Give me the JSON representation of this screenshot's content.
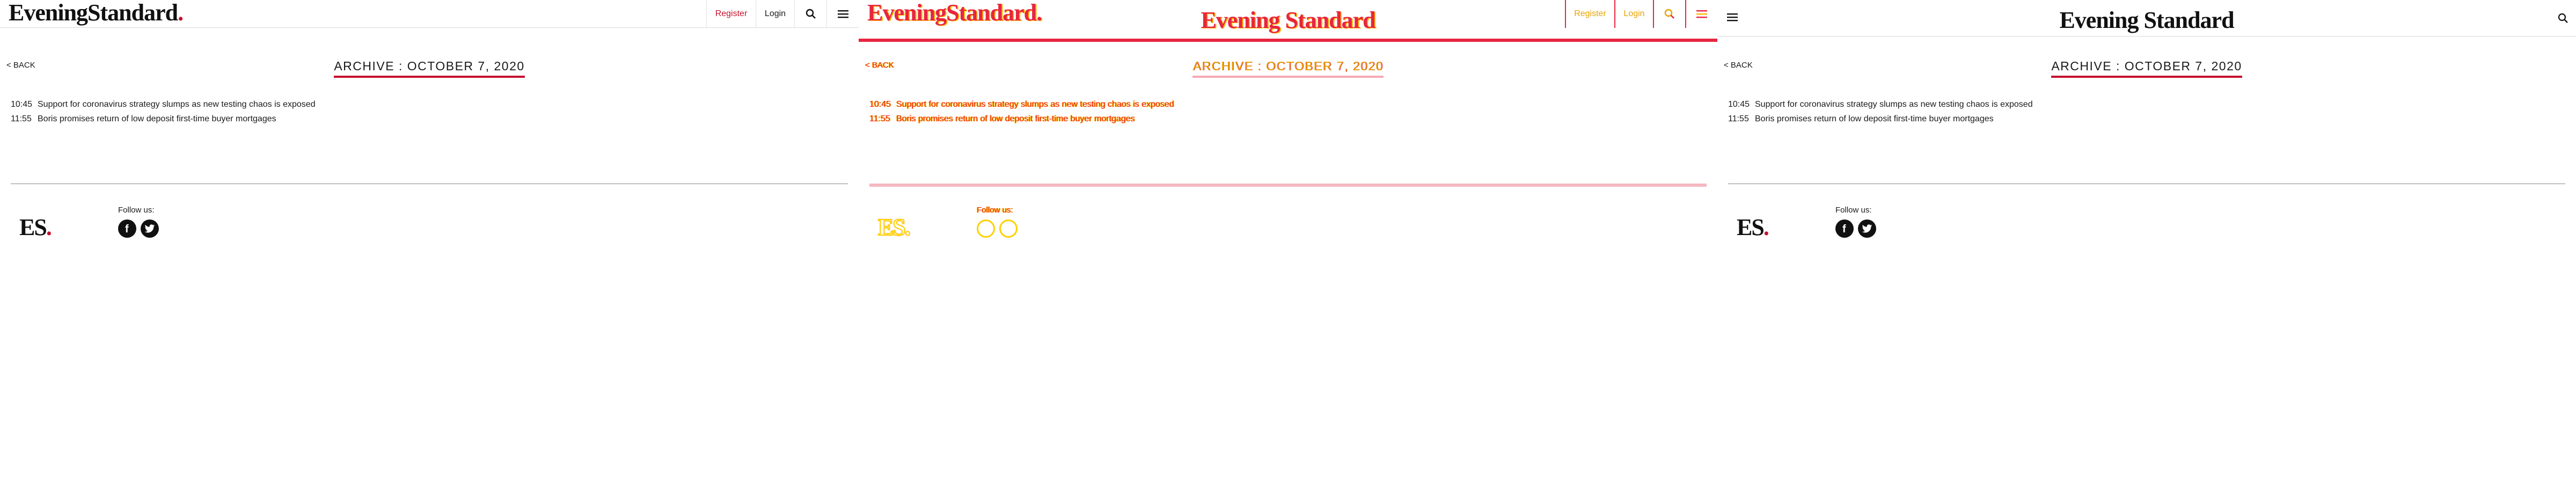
{
  "brand": {
    "name_part1": "Evening",
    "name_part2": "Standard",
    "dot": ".",
    "monogram": "ES",
    "accent_color": "#c4122f"
  },
  "header": {
    "register_label": "Register",
    "login_label": "Login",
    "search_icon": "search-icon",
    "menu_icon": "hamburger-menu-icon"
  },
  "page": {
    "back_label": "< BACK",
    "archive_title": "ARCHIVE : OCTOBER 7, 2020"
  },
  "articles": [
    {
      "time": "10:45",
      "headline": "Support for coronavirus strategy slumps as new testing chaos is exposed"
    },
    {
      "time": "11:55",
      "headline": "Boris promises return of low deposit first-time buyer mortgages"
    }
  ],
  "footer": {
    "follow_label": "Follow us:",
    "socials": [
      "facebook-icon",
      "twitter-icon"
    ]
  }
}
